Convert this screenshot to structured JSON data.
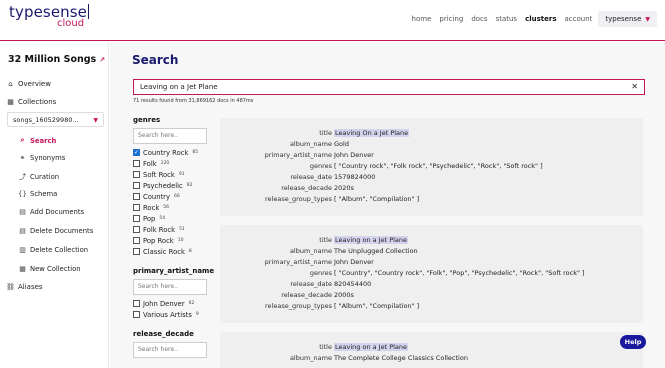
{
  "header": {
    "logo_main": "typesense",
    "logo_sub": "cloud",
    "nav": [
      "home",
      "pricing",
      "docs",
      "status",
      "clusters",
      "account"
    ],
    "account_dropdown": "typesense"
  },
  "sidebar": {
    "cluster_name": "32 Million Songs",
    "overview": "Overview",
    "collections": "Collections",
    "collection_selected": "songs_160529980...",
    "items": [
      "Search",
      "Synonyms",
      "Curation",
      "Schema",
      "Add Documents",
      "Delete Documents",
      "Delete Collection",
      "New Collection"
    ],
    "aliases": "Aliases"
  },
  "main": {
    "title": "Search",
    "search_value": "Leaving on a Jet Plane",
    "results_count": "71 results found from 31,869162 docs in 487ms"
  },
  "facets": [
    {
      "title": "genres",
      "placeholder": "Search here..",
      "options": [
        {
          "label": "Country Rock",
          "count": "85",
          "checked": true
        },
        {
          "label": "Folk",
          "count": "120",
          "checked": false
        },
        {
          "label": "Soft Rock",
          "count": "91",
          "checked": false
        },
        {
          "label": "Psychedelic",
          "count": "82",
          "checked": false
        },
        {
          "label": "Country",
          "count": "66",
          "checked": false
        },
        {
          "label": "Rock",
          "count": "56",
          "checked": false
        },
        {
          "label": "Pop",
          "count": "54",
          "checked": false
        },
        {
          "label": "Folk Rock",
          "count": "51",
          "checked": false
        },
        {
          "label": "Pop Rock",
          "count": "10",
          "checked": false
        },
        {
          "label": "Classic Rock",
          "count": "8",
          "checked": false
        }
      ]
    },
    {
      "title": "primary_artist_name",
      "placeholder": "Search here..",
      "options": [
        {
          "label": "John Denver",
          "count": "62",
          "checked": false
        },
        {
          "label": "Various Artists",
          "count": "9",
          "checked": false
        }
      ]
    },
    {
      "title": "release_decade",
      "placeholder": "Search here..",
      "options": []
    }
  ],
  "hits": [
    {
      "rows": [
        {
          "key": "title",
          "value": "Leaving On a Jet Plane",
          "highlight": true
        },
        {
          "key": "album_name",
          "value": "Gold"
        },
        {
          "key": "primary_artist_name",
          "value": "John Denver"
        },
        {
          "key": "genres",
          "value": "[ \"Country rock\", \"Folk rock\", \"Psychedelic\", \"Rock\", \"Soft rock\" ]"
        },
        {
          "key": "release_date",
          "value": "1579824000"
        },
        {
          "key": "release_decade",
          "value": "2020s"
        },
        {
          "key": "release_group_types",
          "value": "[ \"Album\", \"Compilation\" ]"
        }
      ]
    },
    {
      "rows": [
        {
          "key": "title",
          "value": "Leaving on a Jet Plane",
          "highlight": true
        },
        {
          "key": "album_name",
          "value": "The Unplugged Collection"
        },
        {
          "key": "primary_artist_name",
          "value": "John Denver"
        },
        {
          "key": "genres",
          "value": "[ \"Country\", \"Country rock\", \"Folk\", \"Pop\", \"Psychedelic\", \"Rock\", \"Soft rock\" ]"
        },
        {
          "key": "release_date",
          "value": "820454400"
        },
        {
          "key": "release_decade",
          "value": "2000s"
        },
        {
          "key": "release_group_types",
          "value": "[ \"Album\", \"Compilation\" ]"
        }
      ]
    },
    {
      "rows": [
        {
          "key": "title",
          "value": "Leaving on a Jet Plane",
          "highlight": true
        },
        {
          "key": "album_name",
          "value": "The Complete College Classics Collection"
        }
      ]
    }
  ],
  "help_label": "Help",
  "colors": {
    "brand_navy": "#1a1a6e",
    "brand_pink": "#c5165c",
    "checkbox_blue": "#1f6fd1",
    "highlight": "#d3d3ee"
  }
}
